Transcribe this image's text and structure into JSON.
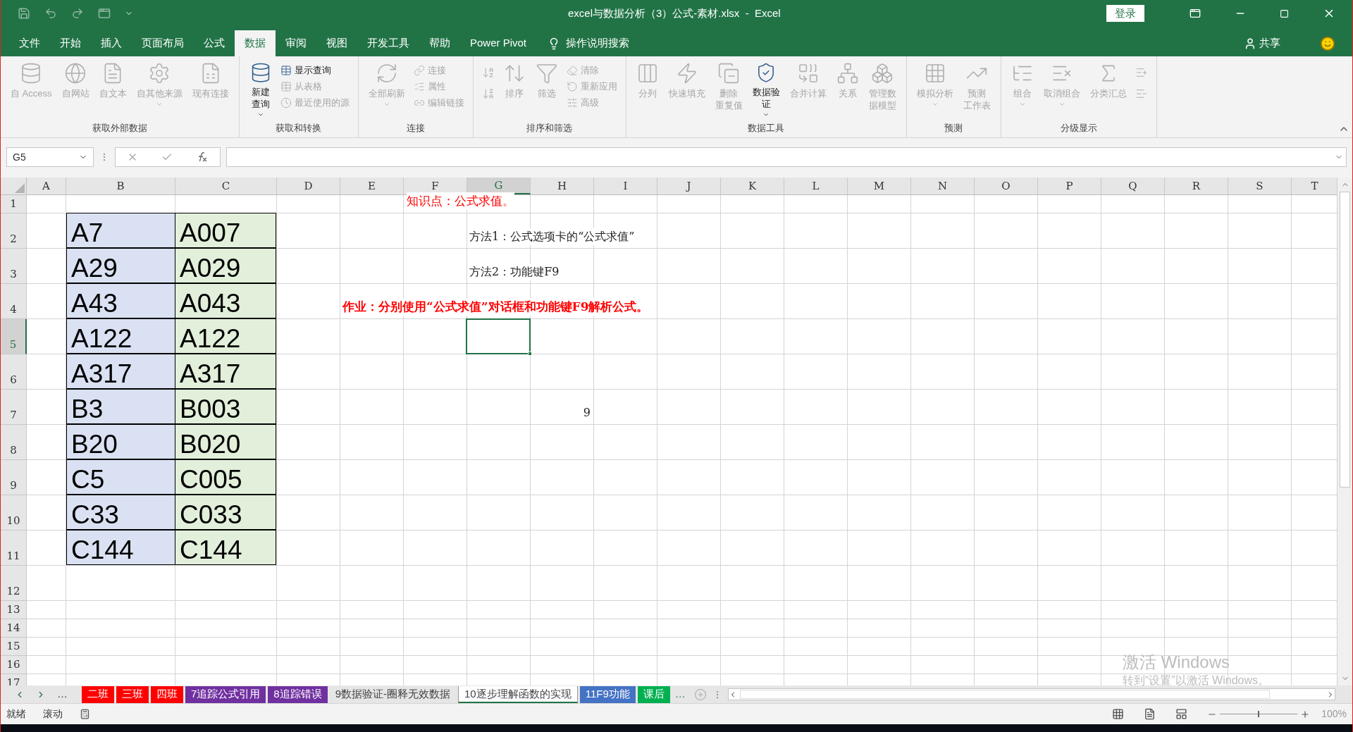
{
  "window": {
    "title": "excel与数据分析（3）公式-素材.xlsx  -  Excel",
    "login": "登录"
  },
  "menu_tabs": [
    {
      "label": "文件",
      "selected": false
    },
    {
      "label": "开始",
      "selected": false
    },
    {
      "label": "插入",
      "selected": false
    },
    {
      "label": "页面布局",
      "selected": false
    },
    {
      "label": "公式",
      "selected": false
    },
    {
      "label": "数据",
      "selected": true
    },
    {
      "label": "审阅",
      "selected": false
    },
    {
      "label": "视图",
      "selected": false
    },
    {
      "label": "开发工具",
      "selected": false
    },
    {
      "label": "帮助",
      "selected": false
    },
    {
      "label": "Power Pivot",
      "selected": false
    }
  ],
  "tell_me": "操作说明搜索",
  "share": "共享",
  "ribbon_groups": [
    {
      "label": "获取外部数据",
      "items": [
        {
          "kind": "large",
          "lines": [
            "自 Access"
          ],
          "disabled": true
        },
        {
          "kind": "large",
          "lines": [
            "自网站"
          ],
          "disabled": true
        },
        {
          "kind": "large",
          "lines": [
            "自文本"
          ],
          "disabled": true
        },
        {
          "kind": "large",
          "lines": [
            "自其他来源"
          ],
          "disabled": true,
          "dropdown": true
        },
        {
          "kind": "large",
          "lines": [
            "现有连接"
          ],
          "disabled": true
        }
      ]
    },
    {
      "label": "获取和转换",
      "items": [
        {
          "kind": "large",
          "lines": [
            "新建",
            "查询"
          ],
          "disabled": false,
          "dropdown": true
        },
        {
          "kind": "small",
          "lines": [
            "显示查询"
          ],
          "disabled": false
        },
        {
          "kind": "small",
          "lines": [
            "从表格"
          ],
          "disabled": true
        },
        {
          "kind": "small",
          "lines": [
            "最近使用的源"
          ],
          "disabled": true
        }
      ]
    },
    {
      "label": "连接",
      "items": [
        {
          "kind": "large",
          "lines": [
            "全部刷新"
          ],
          "disabled": true,
          "dropdown": true
        },
        {
          "kind": "small",
          "lines": [
            "连接"
          ],
          "disabled": true
        },
        {
          "kind": "small",
          "lines": [
            "属性"
          ],
          "disabled": true
        },
        {
          "kind": "small",
          "lines": [
            "编辑链接"
          ],
          "disabled": true
        }
      ]
    },
    {
      "label": "排序和筛选",
      "items": [
        {
          "kind": "icon",
          "disabled": true
        },
        {
          "kind": "icon",
          "disabled": true
        },
        {
          "kind": "large",
          "lines": [
            "排序"
          ],
          "disabled": true
        },
        {
          "kind": "large",
          "lines": [
            "筛选"
          ],
          "disabled": true
        },
        {
          "kind": "small",
          "lines": [
            "清除"
          ],
          "disabled": true
        },
        {
          "kind": "small",
          "lines": [
            "重新应用"
          ],
          "disabled": true
        },
        {
          "kind": "small",
          "lines": [
            "高级"
          ],
          "disabled": true
        }
      ]
    },
    {
      "label": "数据工具",
      "items": [
        {
          "kind": "large",
          "lines": [
            "分列"
          ],
          "disabled": true
        },
        {
          "kind": "large",
          "lines": [
            "快速填充"
          ],
          "disabled": true
        },
        {
          "kind": "large",
          "lines": [
            "删除",
            "重复值"
          ],
          "disabled": true
        },
        {
          "kind": "large",
          "lines": [
            "数据验",
            "证"
          ],
          "disabled": false,
          "dropdown": true
        },
        {
          "kind": "large",
          "lines": [
            "合并计算"
          ],
          "disabled": true
        },
        {
          "kind": "large",
          "lines": [
            "关系"
          ],
          "disabled": true
        },
        {
          "kind": "large",
          "lines": [
            "管理数",
            "据模型"
          ],
          "disabled": true
        }
      ]
    },
    {
      "label": "预测",
      "items": [
        {
          "kind": "large",
          "lines": [
            "模拟分析"
          ],
          "disabled": true,
          "dropdown": true
        },
        {
          "kind": "large",
          "lines": [
            "预测",
            "工作表"
          ],
          "disabled": true
        }
      ]
    },
    {
      "label": "分级显示",
      "items": [
        {
          "kind": "large",
          "lines": [
            "组合"
          ],
          "disabled": true,
          "dropdown": true
        },
        {
          "kind": "large",
          "lines": [
            "取消组合"
          ],
          "disabled": true,
          "dropdown": true
        },
        {
          "kind": "large",
          "lines": [
            "分类汇总"
          ],
          "disabled": true
        },
        {
          "kind": "icon",
          "disabled": true
        },
        {
          "kind": "icon",
          "disabled": true
        }
      ]
    }
  ],
  "name_box": "G5",
  "sheet": {
    "columns": [
      {
        "label": "A",
        "selected": false
      },
      {
        "label": "B",
        "selected": false
      },
      {
        "label": "C",
        "selected": false
      },
      {
        "label": "D",
        "selected": false
      },
      {
        "label": "E",
        "selected": false
      },
      {
        "label": "F",
        "selected": false
      },
      {
        "label": "G",
        "selected": true
      },
      {
        "label": "H",
        "selected": false
      },
      {
        "label": "I",
        "selected": false
      },
      {
        "label": "J",
        "selected": false
      },
      {
        "label": "K",
        "selected": false
      },
      {
        "label": "L",
        "selected": false
      },
      {
        "label": "M",
        "selected": false
      },
      {
        "label": "N",
        "selected": false
      },
      {
        "label": "O",
        "selected": false
      },
      {
        "label": "P",
        "selected": false
      },
      {
        "label": "Q",
        "selected": false
      },
      {
        "label": "R",
        "selected": false
      },
      {
        "label": "S",
        "selected": false
      },
      {
        "label": "T",
        "selected": false
      }
    ],
    "rows": [
      {
        "label": "1",
        "selected": false
      },
      {
        "label": "2",
        "selected": false
      },
      {
        "label": "3",
        "selected": false
      },
      {
        "label": "4",
        "selected": false
      },
      {
        "label": "5",
        "selected": true
      },
      {
        "label": "6",
        "selected": false
      },
      {
        "label": "7",
        "selected": false
      },
      {
        "label": "8",
        "selected": false
      },
      {
        "label": "9",
        "selected": false
      },
      {
        "label": "10",
        "selected": false
      },
      {
        "label": "11",
        "selected": false
      },
      {
        "label": "12",
        "selected": false
      },
      {
        "label": "13",
        "selected": false
      },
      {
        "label": "14",
        "selected": false
      },
      {
        "label": "15",
        "selected": false
      },
      {
        "label": "16",
        "selected": false
      },
      {
        "label": "17",
        "selected": false
      }
    ],
    "data_rows": [
      {
        "code": "A7",
        "result": "A007"
      },
      {
        "code": "A29",
        "result": "A029"
      },
      {
        "code": "A43",
        "result": "A043"
      },
      {
        "code": "A122",
        "result": "A122"
      },
      {
        "code": "A317",
        "result": "A317"
      },
      {
        "code": "B3",
        "result": "B003"
      },
      {
        "code": "B20",
        "result": "B020"
      },
      {
        "code": "C5",
        "result": "C005"
      },
      {
        "code": "C33",
        "result": "C033"
      },
      {
        "code": "C144",
        "result": "C144"
      }
    ],
    "notes": [
      {
        "kind": "note",
        "text": "知识点：公式求值。"
      },
      {
        "kind": "method",
        "text": "方法1：公式选项卡的“公式求值”"
      },
      {
        "kind": "method",
        "text": "方法2：功能键F9"
      },
      {
        "kind": "task",
        "text": "作业：分别使用“公式求值”对话框和功能键F9解析公式。"
      },
      {
        "kind": "number",
        "text": "9"
      }
    ]
  },
  "sheet_tabs": [
    {
      "label": "二班",
      "color": "#ff0000",
      "selected": false
    },
    {
      "label": "三班",
      "color": "#ff0000",
      "selected": false
    },
    {
      "label": "四班",
      "color": "#ff0000",
      "selected": false
    },
    {
      "label": "7追踪公式引用",
      "color": "#7030a0",
      "selected": false
    },
    {
      "label": "8追踪错误",
      "color": "#7030a0",
      "selected": false
    },
    {
      "label": "9数据验证-圈释无效数据",
      "selected": false
    },
    {
      "label": "10逐步理解函数的实现",
      "selected": true
    },
    {
      "label": "11F9功能",
      "color": "#4472c4",
      "selected": false
    },
    {
      "label": "课后",
      "color": "#00b050",
      "selected": false
    }
  ],
  "tabs_more": "…",
  "tabs_more_right": "…",
  "status": {
    "ready": "就绪",
    "scroll": "滚动",
    "zoom": {
      "level": 0.5,
      "reading": "100%"
    }
  },
  "watermark": {
    "title": "激活 Windows",
    "hint": "转到“设置”以激活 Windows。"
  }
}
